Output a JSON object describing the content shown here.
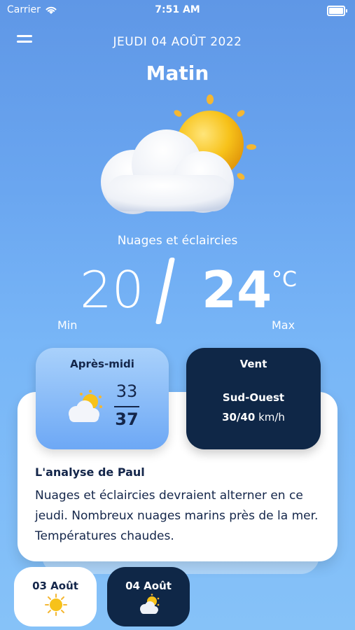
{
  "status": {
    "carrier": "Carrier",
    "time": "7:51 AM"
  },
  "header": {
    "date": "JEUDI 04 AOÛT 2022",
    "period": "Matin"
  },
  "weather": {
    "condition": "Nuages et éclaircies",
    "min": "20",
    "max": "24",
    "unit": "°C",
    "min_label": "Min",
    "max_label": "Max",
    "icon": "sun-behind-cloud-icon"
  },
  "afternoon": {
    "title": "Après-midi",
    "min": "33",
    "max": "37",
    "icon": "sun-behind-cloud-icon"
  },
  "wind": {
    "title": "Vent",
    "direction": "Sud-Ouest",
    "speed": "30/40",
    "unit": "km/h"
  },
  "analysis": {
    "title": "L'analyse de Paul",
    "text": "Nuages et éclaircies devraient alterner en ce jeudi. Nombreux nuages marins près de la mer. Températures chaudes."
  },
  "days": [
    {
      "label": "03 Août",
      "icon": "sun-icon"
    },
    {
      "label": "04 Août",
      "icon": "sun-behind-cloud-icon"
    }
  ],
  "colors": {
    "dark_navy": "#0f2747",
    "sky_blue": "#6aa6f0",
    "sun_yellow": "#f5c21b",
    "text_dark": "#14264a"
  }
}
